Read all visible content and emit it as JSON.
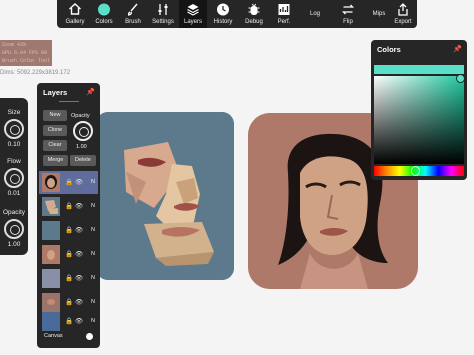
{
  "toolbar": {
    "items": [
      {
        "label": "Gallery",
        "icon": "home-icon"
      },
      {
        "label": "Colors",
        "icon": "color-swatch-icon",
        "swatch_color": "#5ae0c8"
      },
      {
        "label": "Brush",
        "icon": "brush-icon"
      },
      {
        "label": "Settings",
        "icon": "settings-sliders-icon"
      },
      {
        "label": "Layers",
        "icon": "layers-icon",
        "active": true
      },
      {
        "label": "History",
        "icon": "clock-icon"
      },
      {
        "label": "Debug",
        "icon": "debug-icon"
      },
      {
        "label": "Perf.",
        "icon": "performance-icon"
      },
      {
        "label": "Log",
        "icon": ""
      },
      {
        "label": "Flip",
        "icon": "flip-arrows-icon"
      },
      {
        "label": "Mips",
        "icon": ""
      },
      {
        "label": "Export",
        "icon": "export-icon"
      }
    ]
  },
  "debug": {
    "line1": "Zoom 43%",
    "line2": "GPU 6.04 FPS 60",
    "line3": "Brush Color Tool",
    "dims": "Dims: 5092.229x3819.172"
  },
  "sliders": {
    "size_label": "Size",
    "size_value": "0.10",
    "flow_label": "Flow",
    "flow_value": "0.01",
    "opacity_label": "Opacity",
    "opacity_value": "1.00"
  },
  "layers": {
    "title": "Layers",
    "buttons": {
      "new": "New",
      "clone": "Clone",
      "clear": "Clear",
      "merge": "Merge",
      "delete": "Delete"
    },
    "opacity_label": "Opacity",
    "opacity_value": "1.00",
    "rows": [
      {
        "blend": "N",
        "selected": true
      },
      {
        "blend": "N",
        "selected": false
      },
      {
        "blend": "N",
        "selected": false
      },
      {
        "blend": "N",
        "selected": false
      },
      {
        "blend": "N",
        "selected": false
      },
      {
        "blend": "N",
        "selected": false
      },
      {
        "blend": "N",
        "selected": false
      }
    ],
    "canvas_label": "Canvas"
  },
  "colors": {
    "title": "Colors",
    "current_color": "#5ae0c8"
  }
}
